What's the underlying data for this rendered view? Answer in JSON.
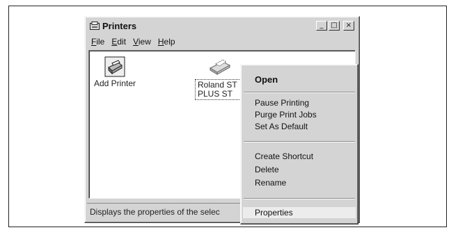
{
  "window": {
    "title": "Printers",
    "controls": {
      "minimize": "_",
      "maximize": "□",
      "close": "×"
    }
  },
  "menubar": [
    "File",
    "Edit",
    "View",
    "Help"
  ],
  "icons": [
    {
      "label": "Add Printer",
      "icon": "add-printer-icon"
    },
    {
      "label_line1": "Roland ST",
      "label_line2": "PLUS ST",
      "icon": "printer-icon"
    }
  ],
  "statusbar": {
    "text": "Displays the properties of the selec"
  },
  "context_menu": {
    "groups": [
      [
        "Open"
      ],
      [
        "Pause Printing",
        "Purge Print Jobs",
        "Set As Default"
      ],
      [
        "Create Shortcut",
        "Delete",
        "Rename"
      ],
      [
        "Properties"
      ]
    ],
    "default_item": "Open",
    "highlighted_item": "Properties"
  }
}
